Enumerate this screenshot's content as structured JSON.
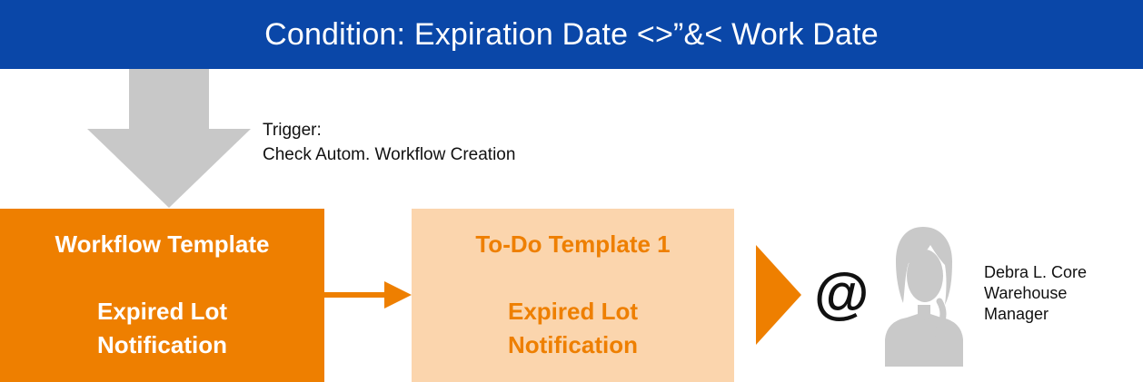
{
  "banner": {
    "title": "Condition: Expiration Date <>”&< Work Date",
    "color": "#0a47a8"
  },
  "trigger": {
    "label": "Trigger:",
    "action": "Check Autom. Workflow Creation"
  },
  "workflow_template": {
    "title": "Workflow Template",
    "name_line1": "Expired Lot",
    "name_line2": "Notification",
    "color": "#ee7f00"
  },
  "todo_template": {
    "title": "To-Do Template 1",
    "name_line1": "Expired Lot",
    "name_line2": "Notification",
    "color": "#fbd5ad"
  },
  "notification": {
    "channel_symbol": "@",
    "icon": "at-sign-icon"
  },
  "recipient": {
    "name": "Debra L. Core",
    "role_line1": "Warehouse",
    "role_line2": "Manager",
    "icon": "user-avatar-icon"
  },
  "colors": {
    "arrow_gray": "#c8c8c8",
    "accent_orange": "#ee7f00",
    "avatar_gray": "#c9c9c9"
  }
}
